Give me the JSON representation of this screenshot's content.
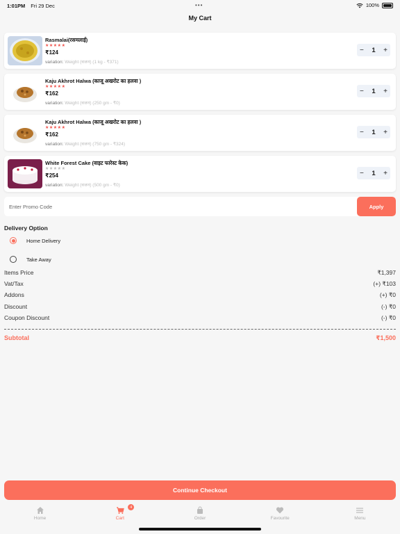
{
  "status_bar": {
    "time": "1:01PM",
    "date": "Fri 29 Dec",
    "battery": "100%"
  },
  "header": {
    "title": "My Cart"
  },
  "cart_items": [
    {
      "name": "Rasmalai(रसमलाई)",
      "stars_filled": 5,
      "price": "₹124",
      "variation_label": "variation:",
      "variation_value": "Weight (वजन) (1 kg - ₹371)",
      "quantity": "1",
      "thumb": "rasmalai"
    },
    {
      "name": "Kaju Akhrot Halwa (काजू अखरोट का हलवा )",
      "stars_filled": 5,
      "price": "₹162",
      "variation_label": "variation:",
      "variation_value": "Weight (वजन) (250 gm - ₹0)",
      "quantity": "1",
      "thumb": "halwa"
    },
    {
      "name": "Kaju Akhrot Halwa (काजू अखरोट का हलवा )",
      "stars_filled": 5,
      "price": "₹162",
      "variation_label": "variation:",
      "variation_value": "Weight (वजन) (750 gm - ₹324)",
      "quantity": "1",
      "thumb": "halwa"
    },
    {
      "name": "White Forest Cake (वाइट फारेस्ट केक)",
      "stars_filled": 0,
      "price": "₹254",
      "variation_label": "variation:",
      "variation_value": "Weight (वजन) (500 gm - ₹0)",
      "quantity": "1",
      "thumb": "cake"
    }
  ],
  "promo": {
    "placeholder": "Enter Promo Code",
    "apply_label": "Apply"
  },
  "delivery": {
    "title": "Delivery Option",
    "options": [
      {
        "label": "Home Delivery",
        "selected": true
      },
      {
        "label": "Take Away",
        "selected": false
      }
    ]
  },
  "summary": {
    "items_price_label": "Items Price",
    "items_price_value": "₹1,397",
    "vat_label": "Vat/Tax",
    "vat_value": "(+) ₹103",
    "addons_label": "Addons",
    "addons_value": "(+) ₹0",
    "discount_label": "Discount",
    "discount_value": "(-) ₹0",
    "coupon_label": "Coupon Discount",
    "coupon_value": "(-) ₹0",
    "subtotal_label": "Subtotal",
    "subtotal_value": "₹1,500"
  },
  "checkout": {
    "label": "Continue Checkout"
  },
  "nav": {
    "home": "Home",
    "cart": "Cart",
    "cart_badge": "4",
    "order": "Order",
    "favourite": "Favourite",
    "menu": "Menu"
  },
  "colors": {
    "accent": "#fb6f5c",
    "star_filled": "#f0514a",
    "star_empty": "#bbbbbb",
    "background": "#f6f6f6"
  },
  "icons": [
    "home-icon",
    "cart-icon",
    "bag-icon",
    "heart-icon",
    "menu-icon",
    "wifi-icon",
    "battery-icon",
    "minus-icon",
    "plus-icon"
  ]
}
